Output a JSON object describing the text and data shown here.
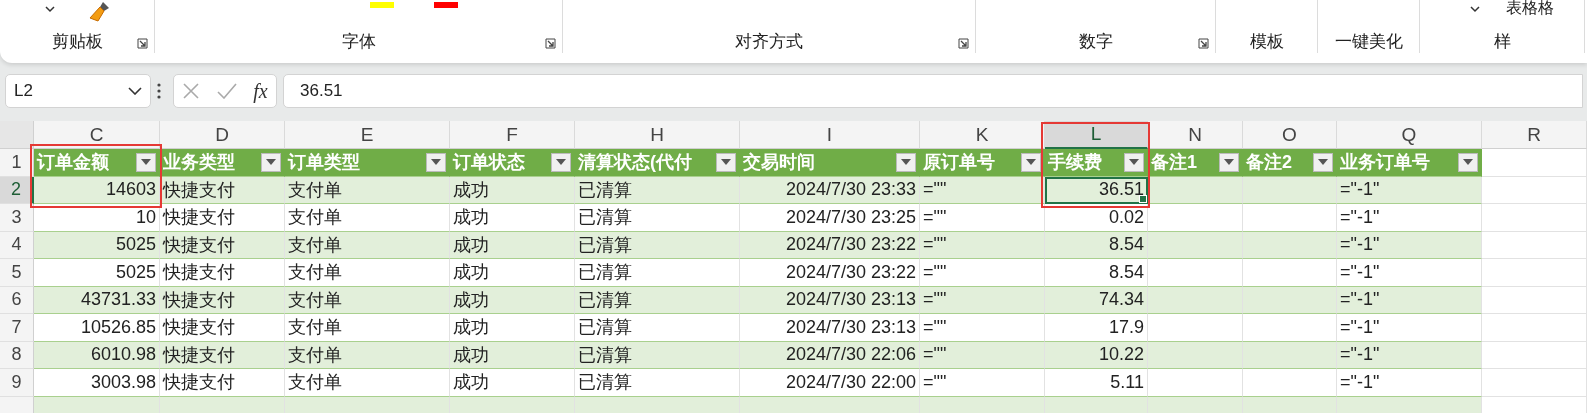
{
  "ribbon": {
    "groups": [
      {
        "kind": "clipboard",
        "label": "剪贴板"
      },
      {
        "kind": "font",
        "label": "字体"
      },
      {
        "kind": "alignment",
        "label": "对齐方式"
      },
      {
        "kind": "number",
        "label": "数字"
      },
      {
        "kind": "plain",
        "label": "模板"
      },
      {
        "kind": "plain",
        "label": "一键美化"
      },
      {
        "kind": "styles",
        "label": "样",
        "button": "表格格"
      }
    ]
  },
  "formula_bar": {
    "name_box": "L2",
    "fx": "fx",
    "value": "36.51"
  },
  "sheet": {
    "columns": [
      {
        "letter": "C",
        "kind": "number",
        "selected": false,
        "red_frame": true,
        "frame_covers_letter": false
      },
      {
        "letter": "D",
        "kind": "text",
        "selected": false,
        "red_frame": false
      },
      {
        "letter": "E",
        "kind": "text",
        "selected": false,
        "red_frame": false
      },
      {
        "letter": "F",
        "kind": "text",
        "selected": false,
        "red_frame": false
      },
      {
        "letter": "H",
        "kind": "text",
        "selected": false,
        "red_frame": false
      },
      {
        "letter": "I",
        "kind": "number",
        "selected": false,
        "red_frame": false
      },
      {
        "letter": "K",
        "kind": "text",
        "selected": false,
        "red_frame": false
      },
      {
        "letter": "L",
        "kind": "number",
        "selected": true,
        "red_frame": true,
        "frame_covers_letter": true
      },
      {
        "letter": "N",
        "kind": "text",
        "selected": false,
        "red_frame": false
      },
      {
        "letter": "O",
        "kind": "text",
        "selected": false,
        "red_frame": false
      },
      {
        "letter": "Q",
        "kind": "text",
        "selected": false,
        "red_frame": false
      },
      {
        "letter": "R",
        "kind": "text",
        "selected": false,
        "red_frame": false
      }
    ],
    "header_row": {
      "number": "1",
      "selected": false,
      "cells": {
        "C": "订单金额",
        "D": "业务类型",
        "E": "订单类型",
        "F": "订单状态",
        "H": "清算状态(代付",
        "I": "交易时间",
        "K": "原订单号",
        "L": "手续费",
        "N": "备注1",
        "O": "备注2",
        "Q": "业务订单号"
      }
    },
    "rows": [
      {
        "number": "2",
        "selected": true,
        "cells": {
          "C": "14603",
          "D": "快捷支付",
          "E": "支付单",
          "F": "成功",
          "H": "已清算",
          "I": "2024/7/30 23:33",
          "K": "=\"\"",
          "L": "36.51",
          "Q": "=\"-1\""
        }
      },
      {
        "number": "3",
        "selected": false,
        "cells": {
          "C": "10",
          "D": "快捷支付",
          "E": "支付单",
          "F": "成功",
          "H": "已清算",
          "I": "2024/7/30 23:25",
          "K": "=\"\"",
          "L": "0.02",
          "Q": "=\"-1\""
        }
      },
      {
        "number": "4",
        "selected": false,
        "cells": {
          "C": "5025",
          "D": "快捷支付",
          "E": "支付单",
          "F": "成功",
          "H": "已清算",
          "I": "2024/7/30 23:22",
          "K": "=\"\"",
          "L": "8.54",
          "Q": "=\"-1\""
        }
      },
      {
        "number": "5",
        "selected": false,
        "cells": {
          "C": "5025",
          "D": "快捷支付",
          "E": "支付单",
          "F": "成功",
          "H": "已清算",
          "I": "2024/7/30 23:22",
          "K": "=\"\"",
          "L": "8.54",
          "Q": "=\"-1\""
        }
      },
      {
        "number": "6",
        "selected": false,
        "cells": {
          "C": "43731.33",
          "D": "快捷支付",
          "E": "支付单",
          "F": "成功",
          "H": "已清算",
          "I": "2024/7/30 23:13",
          "K": "=\"\"",
          "L": "74.34",
          "Q": "=\"-1\""
        }
      },
      {
        "number": "7",
        "selected": false,
        "cells": {
          "C": "10526.85",
          "D": "快捷支付",
          "E": "支付单",
          "F": "成功",
          "H": "已清算",
          "I": "2024/7/30 23:13",
          "K": "=\"\"",
          "L": "17.9",
          "Q": "=\"-1\""
        }
      },
      {
        "number": "8",
        "selected": false,
        "cells": {
          "C": "6010.98",
          "D": "快捷支付",
          "E": "支付单",
          "F": "成功",
          "H": "已清算",
          "I": "2024/7/30 22:06",
          "K": "=\"\"",
          "L": "10.22",
          "Q": "=\"-1\""
        }
      },
      {
        "number": "9",
        "selected": false,
        "cells": {
          "C": "3003.98",
          "D": "快捷支付",
          "E": "支付单",
          "F": "成功",
          "H": "已清算",
          "I": "2024/7/30 22:00",
          "K": "=\"\"",
          "L": "5.11",
          "Q": "=\"-1\""
        }
      }
    ]
  }
}
